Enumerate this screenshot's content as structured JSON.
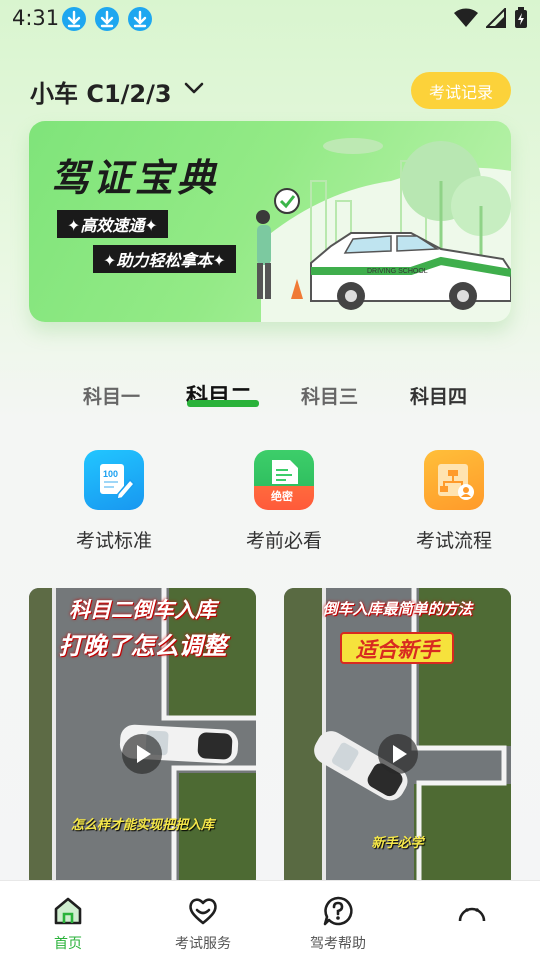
{
  "status": {
    "time": "4:31"
  },
  "header": {
    "car_type": "小车 C1/2/3",
    "record_button": "考试记录"
  },
  "banner": {
    "title": "驾证宝典",
    "tag1": "✦高效速通✦",
    "tag2": "✦助力轻松拿本✦",
    "car_label": "DRIVING SCHOOL"
  },
  "tabs": [
    "科目一",
    "科目二",
    "科目三",
    "科目四"
  ],
  "active_tab": "科目二",
  "entries": [
    {
      "label": "考试标准",
      "icon": "exam-standard-icon",
      "icon_text": "100"
    },
    {
      "label": "考前必看",
      "icon": "must-see-icon",
      "icon_text": "绝密"
    },
    {
      "label": "考试流程",
      "icon": "exam-flow-icon"
    }
  ],
  "cards": [
    {
      "title1": "科目二倒车入库",
      "title2": "打晚了怎么调整",
      "caption": "怎么样才能实现把把入库"
    },
    {
      "title1": "倒车入库最简单的方法",
      "title2": "适合新手",
      "caption": "新手必学"
    }
  ],
  "nav": {
    "items": [
      {
        "label": "首页",
        "icon": "home-icon"
      },
      {
        "label": "考试服务",
        "icon": "heart-icon"
      },
      {
        "label": "驾考帮助",
        "icon": "help-icon"
      },
      {
        "label": "",
        "icon": "profile-icon"
      }
    ]
  },
  "colors": {
    "accent": "#2ab23a",
    "record_button": "#fcd23a",
    "download_icon": "#1ea7f0"
  }
}
